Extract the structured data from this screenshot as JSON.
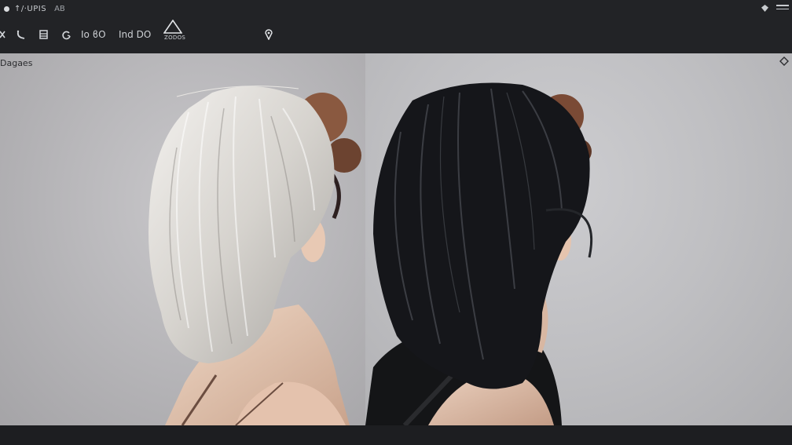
{
  "window": {
    "title": "↑/·UPIS",
    "subtitle": "AB"
  },
  "toolbar": {
    "items": [
      {
        "icon": "close-x-icon"
      },
      {
        "icon": "brush-icon"
      },
      {
        "icon": "layers-icon"
      },
      {
        "icon": "refresh-icon"
      },
      {
        "label": "Io ϐO"
      },
      {
        "label": "Ind DO"
      },
      {
        "icon": "triangle-icon",
        "label": "ZODOS"
      },
      {
        "icon": "pin-icon"
      }
    ]
  },
  "canvas": {
    "label": "Dagaes",
    "panels": [
      {
        "description": "blonde-hair-back-view"
      },
      {
        "description": "black-hair-back-view"
      }
    ]
  },
  "colors": {
    "chrome": "#222326",
    "canvas_left": "#bdbcbf",
    "canvas_right": "#c4c4c7",
    "hair_light": "#dcd9d4",
    "hair_dark": "#111214",
    "bun": "#7a4a35",
    "skin": "#e6c9b4"
  }
}
